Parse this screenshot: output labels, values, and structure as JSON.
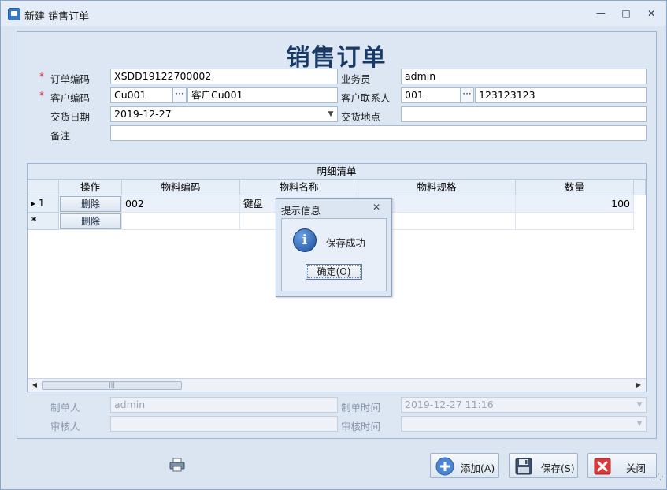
{
  "window": {
    "title": "新建 销售订单",
    "minimize": "—",
    "maximize": "□",
    "close": "✕"
  },
  "form": {
    "title": "销售订单",
    "required_mark": "*",
    "order_no_label": "订单编码",
    "order_no_value": "XSDD19122700002",
    "salesman_label": "业务员",
    "salesman_value": "admin",
    "customer_code_label": "客户编码",
    "customer_code_value": "Cu001",
    "customer_name_value": "客户Cu001",
    "contact_label": "客户联系人",
    "contact_code_value": "001",
    "contact_phone_value": "123123123",
    "delivery_date_label": "交货日期",
    "delivery_date_value": "2019-12-27",
    "delivery_place_label": "交货地点",
    "delivery_place_value": "",
    "remark_label": "备注",
    "remark_value": "",
    "picker_glyph": "···",
    "dropdown_glyph": "▼"
  },
  "grid": {
    "caption": "明细清单",
    "columns": [
      "操作",
      "物料编码",
      "物料名称",
      "物料规格",
      "数量"
    ],
    "rows": [
      {
        "indicator": "▸ 1",
        "action": "删除",
        "material_code": "002",
        "material_name": "键盘",
        "spec": "",
        "qty": "100"
      },
      {
        "indicator": "*",
        "action": "删除",
        "material_code": "",
        "material_name": "",
        "spec": "",
        "qty": ""
      }
    ],
    "scroll_left": "◀",
    "scroll_right": "▶",
    "thumb_grip": "|||"
  },
  "footer": {
    "creator_label": "制单人",
    "creator_value": "admin",
    "create_time_label": "制单时间",
    "create_time_value": "2019-12-27 11:16",
    "auditor_label": "审核人",
    "auditor_value": "",
    "audit_time_label": "审核时间",
    "audit_time_value": ""
  },
  "dialog": {
    "title": "提示信息",
    "close": "✕",
    "icon": "i",
    "message": "保存成功",
    "ok_label": "确定(O)"
  },
  "buttons": {
    "add_label": "添加(A)",
    "save_label": "保存(S)",
    "close_label": "关闭"
  },
  "icons": {
    "add": "plus-circle-icon",
    "save": "floppy-disk-icon",
    "close": "close-x-icon",
    "print": "printer-icon",
    "info": "info-icon"
  },
  "colors": {
    "accent": "#1a3a66",
    "required": "#e03030",
    "close_red": "#d83a3a"
  }
}
